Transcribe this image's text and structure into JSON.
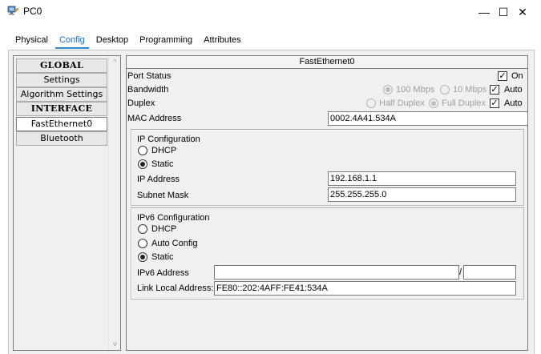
{
  "window": {
    "title": "PC0",
    "minimize_glyph": "—",
    "maximize_glyph": "☐",
    "close_glyph": "✕",
    "icon": "pc-icon"
  },
  "tabs": [
    "Physical",
    "Config",
    "Desktop",
    "Programming",
    "Attributes"
  ],
  "active_tab": "Config",
  "sidebar": {
    "items": [
      {
        "label": "GLOBAL",
        "kind": "header"
      },
      {
        "label": "Settings",
        "kind": "item"
      },
      {
        "label": "Algorithm Settings",
        "kind": "item"
      },
      {
        "label": "INTERFACE",
        "kind": "header"
      },
      {
        "label": "FastEthernet0",
        "kind": "item",
        "selected": true
      },
      {
        "label": "Bluetooth",
        "kind": "item"
      }
    ],
    "scroll_up": "^",
    "scroll_down": "v"
  },
  "panel": {
    "title": "FastEthernet0",
    "port_status": {
      "label": "Port Status",
      "on_label": "On",
      "on_checked": true,
      "check_mark": "✓"
    },
    "bandwidth": {
      "label": "Bandwidth",
      "opt1": "100 Mbps",
      "opt2": "10 Mbps",
      "auto_label": "Auto",
      "auto_checked": true,
      "check_mark": "✓"
    },
    "duplex": {
      "label": "Duplex",
      "opt1": "Half Duplex",
      "opt2": "Full Duplex",
      "auto_label": "Auto",
      "auto_checked": true,
      "check_mark": "✓"
    },
    "mac": {
      "label": "MAC Address",
      "value": "0002.4A41.534A"
    },
    "ipv4": {
      "heading": "IP Configuration",
      "dhcp_label": "DHCP",
      "static_label": "Static",
      "mode": "Static",
      "ip_label": "IP Address",
      "ip_value": "192.168.1.1",
      "mask_label": "Subnet Mask",
      "mask_value": "255.255.255.0"
    },
    "ipv6": {
      "heading": "IPv6 Configuration",
      "dhcp_label": "DHCP",
      "auto_label": "Auto Config",
      "static_label": "Static",
      "mode": "Static",
      "addr_label": "IPv6 Address",
      "addr_value": "",
      "prefix_sep": "/",
      "prefix_value": "",
      "link_local_label": "Link Local Address:",
      "link_local_value": "FE80::202:4AFF:FE41:534A"
    }
  }
}
